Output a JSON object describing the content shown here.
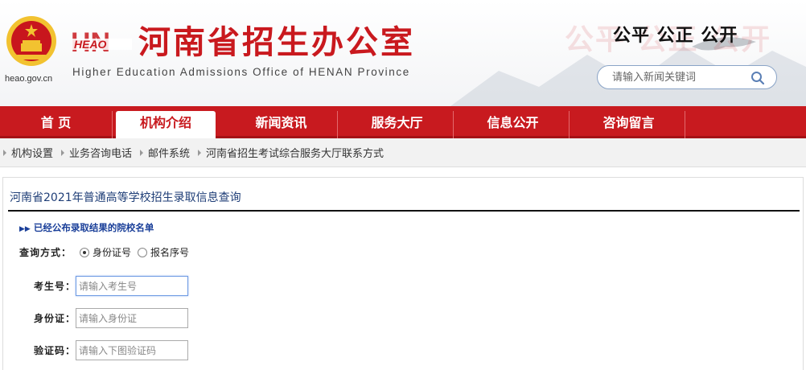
{
  "header": {
    "site_url": "heao.gov.cn",
    "logo_mark": "HEAO",
    "org_name": "河南省招生办公室",
    "org_en": "Higher Education Admissions Office of HENAN Province",
    "slogan": "公平 公正 公开",
    "search_placeholder": "请输入新闻关键词",
    "icons": [
      "national-emblem-icon",
      "heao-logo-icon",
      "search-icon"
    ],
    "accent_color": "#c81a1f"
  },
  "nav": {
    "items": [
      {
        "label": "首 页"
      },
      {
        "label": "机构介绍"
      },
      {
        "label": "新闻资讯"
      },
      {
        "label": "服务大厅"
      },
      {
        "label": "信息公开"
      },
      {
        "label": "咨询留言"
      }
    ],
    "active": "机构介绍"
  },
  "subnav": {
    "items": [
      {
        "label": "机构设置"
      },
      {
        "label": "业务咨询电话"
      },
      {
        "label": "邮件系统"
      },
      {
        "label": "河南省招生考试综合服务大厅联系方式"
      }
    ]
  },
  "panel": {
    "title": "河南省2021年普通高等学校招生录取信息查询",
    "announce": "已经公布录取结果的院校名单",
    "mode_label": "查询方式：",
    "mode_options": [
      {
        "label": "身份证号",
        "checked": true
      },
      {
        "label": "报名序号",
        "checked": false
      }
    ],
    "fields": [
      {
        "label": "考生号：",
        "placeholder": "请输入考生号"
      },
      {
        "label": "身份证：",
        "placeholder": "请输入身份证"
      },
      {
        "label": "验证码：",
        "placeholder": "请输入下图验证码"
      }
    ]
  }
}
